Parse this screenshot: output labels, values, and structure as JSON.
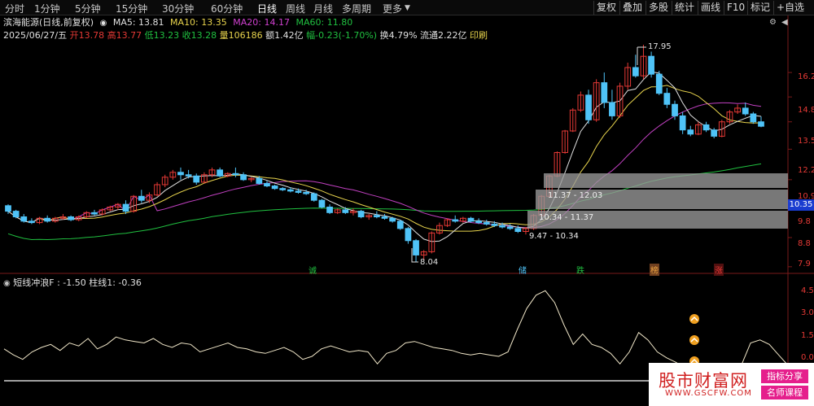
{
  "toolbar": {
    "timeframes": [
      "分时",
      "1分钟",
      "5分钟",
      "15分钟",
      "30分钟",
      "60分钟",
      "日线",
      "周线",
      "月线",
      "多周期",
      "更多"
    ],
    "active": "日线",
    "right_buttons": [
      "复权",
      "叠加",
      "多股",
      "统计",
      "画线",
      "F10",
      "标记",
      "+自选"
    ]
  },
  "stock": {
    "name": "滨海能源(日线,前复权)",
    "ma5": "MA5: 13.81",
    "ma10": "MA10: 13.35",
    "ma20": "MA20: 14.17",
    "ma60": "MA60: 11.80"
  },
  "quote": {
    "date": "2025/06/27/五",
    "open": "开13.78",
    "high": "高13.77",
    "low": "低13.23",
    "close": "收13.28",
    "volume": "量106186",
    "amount": "额1.42亿",
    "change": "幅-0.23(-1.70%)",
    "turnover": "换4.79%",
    "float": "流通2.22亿",
    "print": "印刷"
  },
  "price_axis": {
    "ticks": [
      "16.2",
      "14.8",
      "13.5",
      "12.2",
      "10.9",
      "9.8",
      "8.8",
      "7.9"
    ],
    "current_label": "10.35"
  },
  "annotations": {
    "high_label": "17.95",
    "low_label": "8.04",
    "zones": [
      "11.37 - 12.03",
      "10.34 - 11.37",
      "9.47 - 10.34"
    ],
    "markers": [
      "诚",
      "储",
      "跌",
      "榜",
      "涨"
    ]
  },
  "indicator": {
    "name": "短线冲浪F",
    "value": ": -1.50",
    "bar": "柱线1: -0.36",
    "ticks": [
      "4.5",
      "3.0",
      "1.5",
      "0.0"
    ]
  },
  "colors": {
    "bg": "#000000",
    "up": "#e53935",
    "down": "#4fc3f7",
    "ma5": "#e0e0e0",
    "ma10": "#e8d44d",
    "ma20": "#c040c0",
    "ma60": "#20c040",
    "indicator_line": "#f0e6c8",
    "zone": "#9a9a9a"
  },
  "chart_data": {
    "type": "candlestick",
    "series": [
      {
        "values": [
          9.9,
          9.95,
          9.6,
          9.7
        ]
      },
      {
        "values": [
          9.7,
          9.75,
          9.45,
          9.5
        ]
      },
      {
        "values": [
          9.5,
          9.6,
          9.3,
          9.35
        ]
      },
      {
        "values": [
          9.35,
          9.45,
          9.25,
          9.3
        ]
      },
      {
        "values": [
          9.3,
          9.5,
          9.25,
          9.45
        ]
      },
      {
        "values": [
          9.45,
          9.55,
          9.3,
          9.35
        ]
      },
      {
        "values": [
          9.35,
          9.5,
          9.3,
          9.45
        ]
      },
      {
        "values": [
          9.45,
          9.6,
          9.4,
          9.5
        ]
      },
      {
        "values": [
          9.5,
          9.55,
          9.35,
          9.4
        ]
      },
      {
        "values": [
          9.4,
          9.55,
          9.35,
          9.5
        ]
      },
      {
        "values": [
          9.5,
          9.7,
          9.45,
          9.65
        ]
      },
      {
        "values": [
          9.65,
          9.75,
          9.55,
          9.6
        ]
      },
      {
        "values": [
          9.6,
          9.8,
          9.55,
          9.75
        ]
      },
      {
        "values": [
          9.75,
          9.9,
          9.7,
          9.85
        ]
      },
      {
        "values": [
          9.85,
          10.0,
          9.75,
          9.95
        ]
      },
      {
        "values": [
          9.95,
          10.1,
          9.6,
          9.7
        ]
      },
      {
        "values": [
          9.7,
          10.3,
          9.65,
          10.25
        ]
      },
      {
        "values": [
          10.25,
          10.5,
          10.0,
          10.1
        ]
      },
      {
        "values": [
          10.1,
          10.4,
          10.0,
          10.3
        ]
      },
      {
        "values": [
          10.3,
          10.8,
          10.25,
          10.7
        ]
      },
      {
        "values": [
          10.7,
          11.1,
          10.6,
          11.0
        ]
      },
      {
        "values": [
          11.0,
          11.3,
          10.9,
          11.2
        ]
      },
      {
        "values": [
          11.2,
          11.4,
          10.9,
          11.1
        ]
      },
      {
        "values": [
          11.1,
          11.3,
          10.95,
          11.05
        ]
      },
      {
        "values": [
          11.05,
          11.15,
          10.7,
          10.8
        ]
      },
      {
        "values": [
          10.8,
          11.2,
          10.75,
          11.1
        ]
      },
      {
        "values": [
          11.1,
          11.4,
          11.0,
          11.3
        ]
      },
      {
        "values": [
          11.3,
          11.4,
          11.0,
          11.05
        ]
      },
      {
        "values": [
          11.05,
          11.2,
          11.0,
          11.15
        ]
      },
      {
        "values": [
          11.15,
          11.4,
          11.0,
          11.1
        ]
      },
      {
        "values": [
          11.1,
          11.2,
          10.85,
          10.9
        ]
      },
      {
        "values": [
          10.9,
          11.0,
          10.8,
          10.95
        ]
      },
      {
        "values": [
          10.95,
          11.05,
          10.7,
          10.75
        ]
      },
      {
        "values": [
          10.75,
          10.85,
          10.6,
          10.65
        ]
      },
      {
        "values": [
          10.65,
          10.7,
          10.5,
          10.55
        ]
      },
      {
        "values": [
          10.55,
          10.6,
          10.45,
          10.5
        ]
      },
      {
        "values": [
          10.5,
          10.6,
          10.4,
          10.45
        ]
      },
      {
        "values": [
          10.45,
          10.55,
          10.35,
          10.4
        ]
      },
      {
        "values": [
          10.4,
          10.5,
          10.3,
          10.35
        ]
      },
      {
        "values": [
          10.35,
          10.4,
          10.05,
          10.1
        ]
      },
      {
        "values": [
          10.1,
          10.15,
          9.8,
          9.85
        ]
      },
      {
        "values": [
          9.85,
          9.95,
          9.6,
          9.65
        ]
      },
      {
        "values": [
          9.65,
          9.8,
          9.6,
          9.75
        ]
      },
      {
        "values": [
          9.75,
          9.85,
          9.6,
          9.65
        ]
      },
      {
        "values": [
          9.65,
          9.8,
          9.55,
          9.7
        ]
      },
      {
        "values": [
          9.7,
          9.75,
          9.45,
          9.5
        ]
      },
      {
        "values": [
          9.5,
          9.6,
          9.4,
          9.55
        ]
      },
      {
        "values": [
          9.55,
          9.7,
          9.45,
          9.5
        ]
      },
      {
        "values": [
          9.5,
          9.6,
          9.4,
          9.45
        ]
      },
      {
        "values": [
          9.45,
          9.5,
          9.3,
          9.35
        ]
      },
      {
        "values": [
          9.35,
          9.4,
          9.05,
          9.1
        ]
      },
      {
        "values": [
          9.1,
          9.15,
          8.6,
          8.7
        ]
      },
      {
        "values": [
          8.7,
          8.75,
          8.04,
          8.25
        ]
      },
      {
        "values": [
          8.25,
          8.4,
          8.1,
          8.35
        ]
      },
      {
        "values": [
          8.35,
          9.0,
          8.3,
          8.95
        ]
      },
      {
        "values": [
          8.95,
          9.3,
          8.9,
          9.2
        ]
      },
      {
        "values": [
          9.2,
          9.45,
          9.15,
          9.4
        ]
      },
      {
        "values": [
          9.4,
          9.55,
          9.3,
          9.35
        ]
      },
      {
        "values": [
          9.35,
          9.5,
          9.3,
          9.45
        ]
      },
      {
        "values": [
          9.45,
          9.5,
          9.3,
          9.35
        ]
      },
      {
        "values": [
          9.35,
          9.45,
          9.25,
          9.3
        ]
      },
      {
        "values": [
          9.3,
          9.4,
          9.2,
          9.25
        ]
      },
      {
        "values": [
          9.25,
          9.35,
          9.15,
          9.2
        ]
      },
      {
        "values": [
          9.2,
          9.3,
          9.1,
          9.15
        ]
      },
      {
        "values": [
          9.15,
          9.25,
          9.05,
          9.1
        ]
      },
      {
        "values": [
          9.1,
          9.2,
          8.95,
          9.0
        ]
      },
      {
        "values": [
          9.0,
          9.15,
          8.9,
          9.1
        ]
      },
      {
        "values": [
          9.1,
          9.6,
          9.05,
          9.55
        ]
      },
      {
        "values": [
          9.55,
          10.3,
          9.5,
          10.25
        ]
      },
      {
        "values": [
          10.25,
          11.1,
          10.2,
          11.05
        ]
      },
      {
        "values": [
          11.05,
          12.1,
          11.0,
          12.05
        ]
      },
      {
        "values": [
          12.05,
          13.1,
          12.0,
          13.05
        ]
      },
      {
        "values": [
          13.05,
          14.2,
          13.0,
          14.1
        ]
      },
      {
        "values": [
          14.1,
          15.1,
          14.0,
          14.9
        ]
      },
      {
        "values": [
          14.9,
          15.2,
          13.4,
          13.6
        ]
      },
      {
        "values": [
          13.6,
          15.8,
          13.5,
          15.6
        ]
      },
      {
        "values": [
          15.6,
          16.2,
          14.2,
          14.5
        ]
      },
      {
        "values": [
          14.5,
          15.2,
          13.6,
          13.8
        ]
      },
      {
        "values": [
          13.8,
          15.6,
          13.7,
          15.4
        ]
      },
      {
        "values": [
          15.4,
          16.8,
          15.2,
          16.5
        ]
      },
      {
        "values": [
          16.5,
          17.3,
          15.9,
          16.0
        ]
      },
      {
        "values": [
          16.0,
          17.95,
          15.8,
          17.2
        ]
      },
      {
        "values": [
          17.2,
          17.5,
          15.9,
          16.1
        ]
      },
      {
        "values": [
          16.1,
          16.3,
          14.9,
          15.0
        ]
      },
      {
        "values": [
          15.0,
          15.3,
          14.2,
          14.4
        ]
      },
      {
        "values": [
          14.4,
          14.6,
          13.6,
          13.8
        ]
      },
      {
        "values": [
          13.8,
          14.0,
          12.9,
          13.1
        ]
      },
      {
        "values": [
          13.1,
          13.3,
          12.8,
          12.9
        ]
      },
      {
        "values": [
          12.9,
          13.5,
          12.85,
          13.35
        ]
      },
      {
        "values": [
          13.35,
          13.5,
          13.0,
          13.1
        ]
      },
      {
        "values": [
          13.1,
          13.2,
          12.7,
          12.8
        ]
      },
      {
        "values": [
          12.8,
          13.6,
          12.75,
          13.5
        ]
      },
      {
        "values": [
          13.5,
          14.1,
          13.4,
          14.0
        ]
      },
      {
        "values": [
          14.0,
          14.4,
          13.9,
          14.2
        ]
      },
      {
        "values": [
          14.2,
          14.5,
          13.8,
          13.9
        ]
      },
      {
        "values": [
          13.9,
          14.0,
          13.4,
          13.5
        ]
      },
      {
        "values": [
          13.5,
          13.77,
          13.23,
          13.28
        ]
      }
    ]
  }
}
